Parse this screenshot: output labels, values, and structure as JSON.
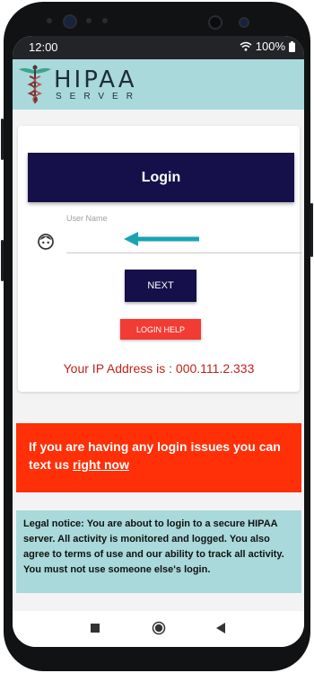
{
  "status_bar": {
    "time": "12:00",
    "battery": "100%",
    "icons": [
      "wifi-icon",
      "battery-icon"
    ]
  },
  "header": {
    "logo_title": "HIPAA",
    "logo_subtitle": "SERVER",
    "logo_icon": "caduceus-icon"
  },
  "login_form": {
    "title": "Login",
    "username_label": "User Name",
    "username_value": "",
    "username_icon": "user-face-icon",
    "pointer_icon": "arrow-left-icon",
    "next_label": "NEXT",
    "help_label": "LOGIN HELP",
    "ip_text": "Your IP Address is : 000.111.2.333"
  },
  "alert": {
    "text": "If you are having any login issues you can text us ",
    "link_text": "right now"
  },
  "legal": {
    "text": "Legal notice: You are about to login to a secure HIPAA server. All activity is monitored and logged. You also agree to terms of use and our ability to track all activity. You must not use someone else's login."
  },
  "nav_bar": {
    "buttons": [
      "recents-icon",
      "home-icon",
      "back-icon"
    ]
  },
  "colors": {
    "header_bg": "#a9d9da",
    "navy": "#15104a",
    "alert_red": "#ff2f08",
    "help_red": "#f23b33",
    "ip_red": "#c0221b",
    "arrow_teal": "#1aa3b4"
  }
}
